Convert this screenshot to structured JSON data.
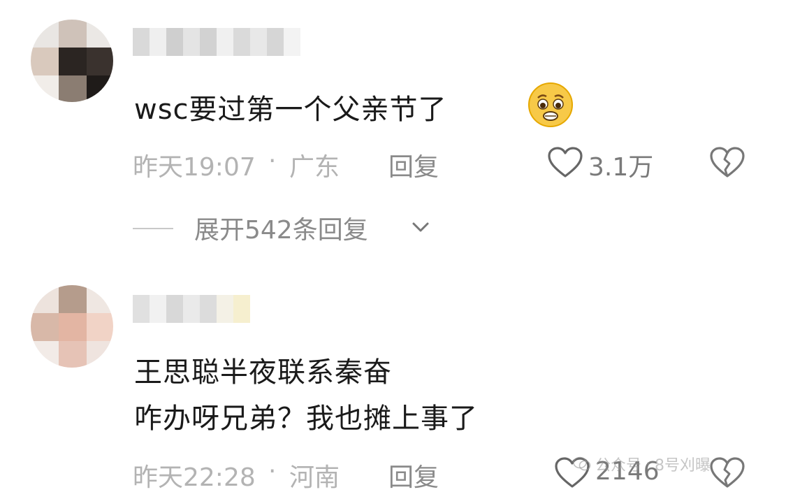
{
  "comments": [
    {
      "content_lines": [
        "wsc要过第一个父亲节了"
      ],
      "emoji": "pleading-face-emoji",
      "time": "昨天19:07",
      "location": "广东",
      "separator": "·",
      "reply_label": "回复",
      "like_count": "3.1万",
      "expand_replies": "展开542条回复"
    },
    {
      "content_lines": [
        "王思聪半夜联系秦奋",
        "咋办呀兄弟？我也摊上事了"
      ],
      "time": "昨天22:28",
      "location": "河南",
      "separator": "·",
      "reply_label": "回复",
      "like_count": "2146"
    }
  ],
  "icons": {
    "like": "heart-outline-icon",
    "dislike": "broken-heart-icon",
    "expand": "chevron-down-icon"
  },
  "watermark": {
    "account": "公众号",
    "separator": "·",
    "name": "8号刈曝"
  },
  "colors": {
    "text_primary": "#1a1a1a",
    "text_meta": "#b3b3b3",
    "text_secondary": "#8a8a8a",
    "background": "#ffffff"
  }
}
